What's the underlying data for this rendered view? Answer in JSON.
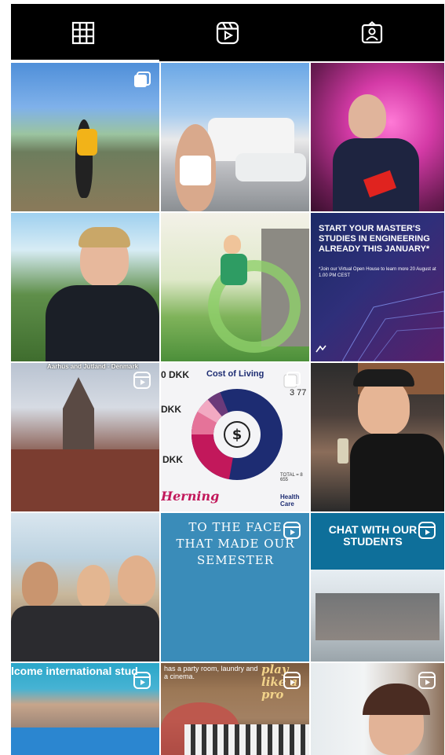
{
  "tabs": [
    {
      "name": "grid",
      "icon": "grid-icon"
    },
    {
      "name": "reels",
      "icon": "reels-icon"
    },
    {
      "name": "tagged",
      "icon": "tagged-icon"
    }
  ],
  "posts": {
    "master": {
      "headline": "START YOUR MASTER'S STUDIES IN ENGINEERING ALREADY THIS JANUARY*",
      "sub": "*Join our Virtual Open House to learn more 20 August at 1.00 PM CEST"
    },
    "cathedral": {
      "caption": "Aarhus and Jutland - Denmark"
    },
    "cost": {
      "title": "Cost of Living",
      "left1": "0 DKK",
      "left2": "DKK",
      "left3": "DKK",
      "right1": "3 77",
      "total": "TOTAL = 8 655",
      "health": "Health Care",
      "brand": "Herning"
    },
    "semester": {
      "text": "TO THE FACE THAT MADE OUR SEMESTER"
    },
    "chat": {
      "text": "CHAT WITH OUR STUDENTS"
    },
    "welcome": {
      "text": "lcome international stud"
    },
    "lounge": {
      "text": "has a party room, laundry and a cinema."
    },
    "lounge_script": {
      "text": "play like a pro"
    }
  },
  "colors": {
    "tabbar_bg": "#000000",
    "icon_color": "#ffffff",
    "cost_donut_main": "#1d2c72",
    "cost_donut_accent": "#c2185b"
  }
}
